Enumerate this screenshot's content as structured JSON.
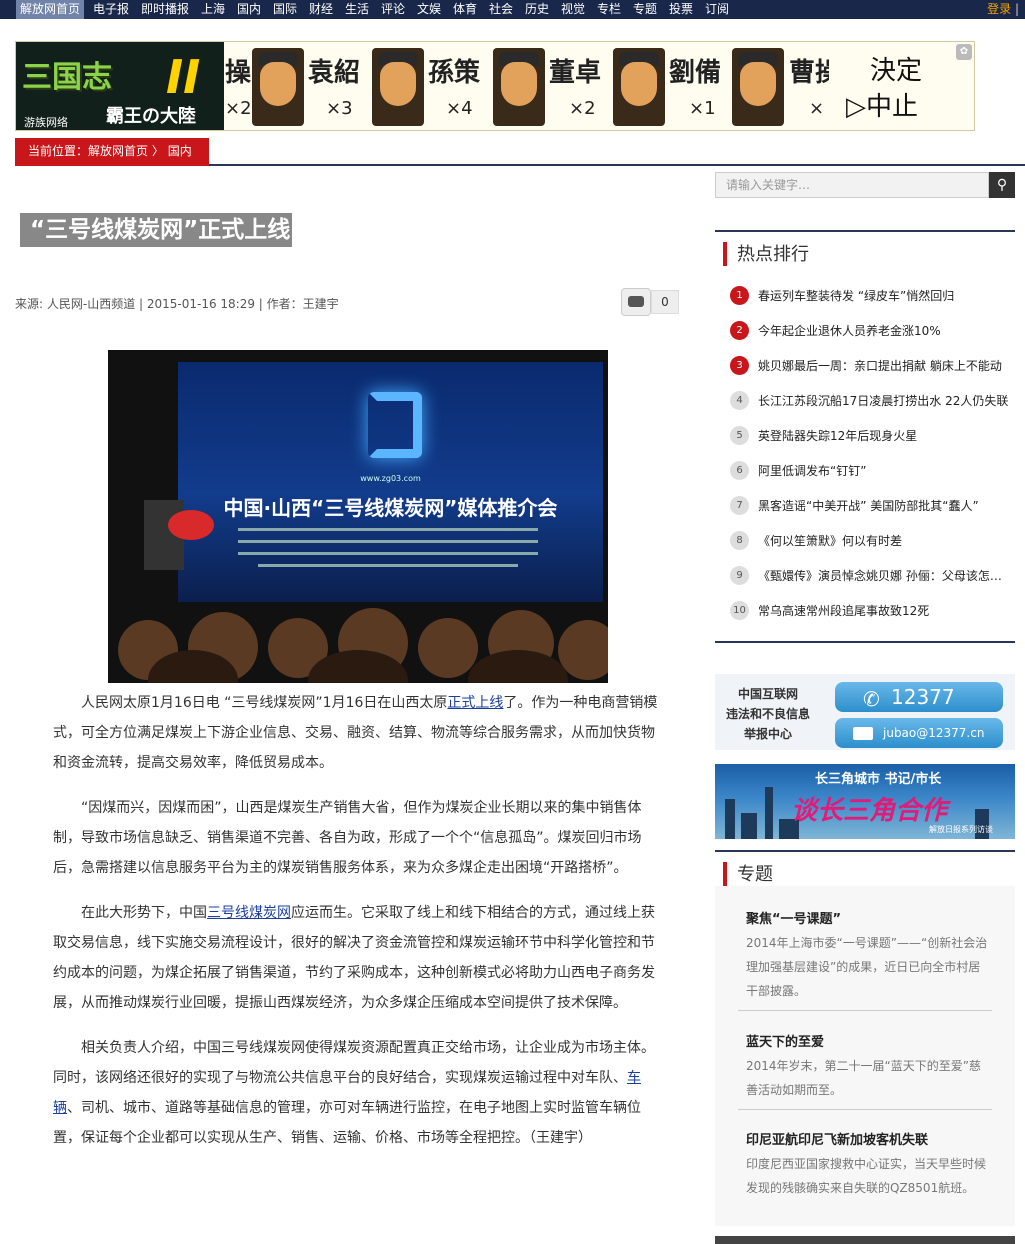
{
  "topnav": {
    "items": [
      "解放网首页",
      "电子报",
      "即时播报",
      "上海",
      "国内",
      "国际",
      "财经",
      "生活",
      "评论",
      "文娱",
      "体育",
      "社会",
      "历史",
      "视觉",
      "专栏",
      "专题",
      "投票",
      "订阅"
    ],
    "login": "登录",
    "sep": "|"
  },
  "banner": {
    "logo_title": "三国志",
    "logo_numeral": "II",
    "logo_subtitle": "霸王の大陸",
    "logo_brand": "游族网络",
    "generals": [
      {
        "name": "袁紹",
        "count": "×3"
      },
      {
        "name": "孫策",
        "count": "×4"
      },
      {
        "name": "董卓",
        "count": "×2"
      },
      {
        "name": "劉備",
        "count": "×1"
      },
      {
        "name": "曹操",
        "count": "×"
      }
    ],
    "lead_name": "操",
    "lead_count": "×2",
    "decide_label": "決定",
    "stop_label": "▷中止"
  },
  "breadcrumb": {
    "label": "当前位置：",
    "home": "解放网首页",
    "sep": "〉",
    "current": "国内"
  },
  "search": {
    "placeholder": "请输入关键字…",
    "button_icon": "search-icon"
  },
  "article": {
    "title": "“三号线煤炭网”正式上线",
    "meta": "来源: 人民网-山西频道 | 2015-01-16 18:29 | 作者：王建宇",
    "comment_count": "0",
    "photo": {
      "url_text": "www.zg03.com",
      "screen_title": "中国·山西“三号线煤炭网”媒体推介会"
    },
    "p1_a": "人民网太原1月16日电 “三号线煤炭网”1月16日在山西太原",
    "p1_link": "正式上线",
    "p1_b": "了。作为一种电商营销模式，可全方位满足煤炭上下游企业信息、交易、融资、结算、物流等综合服务需求，从而加快货物和资金流转，提高交易效率，降低贸易成本。",
    "p2": "“因煤而兴，因煤而困”，山西是煤炭生产销售大省，但作为煤炭企业长期以来的集中销售体制，导致市场信息缺乏、销售渠道不完善、各自为政，形成了一个个“信息孤岛”。煤炭回归市场后，急需搭建以信息服务平台为主的煤炭销售服务体系，来为众多煤企走出困境“开路搭桥”。",
    "p3_a": "在此大形势下，中国",
    "p3_link": "三号线煤炭网",
    "p3_b": "应运而生。它采取了线上和线下相结合的方式，通过线上获取交易信息，线下实施交易流程设计，很好的解决了资金流管控和煤炭运输环节中科学化管控和节约成本的问题，为煤企拓展了销售渠道，节约了采购成本，这种创新模式必将助力山西电子商务发展，从而推动煤炭行业回暖，提振山西煤炭经济，为众多煤企压缩成本空间提供了技术保障。",
    "p4_a": "相关负责人介绍，中国三号线煤炭网使得煤炭资源配置真正交给市场，让企业成为市场主体。同时，该网络还很好的实现了与物流公共信息平台的良好结合，实现煤炭运输过程中对车队、",
    "p4_link": "车辆",
    "p4_b": "、司机、城市、道路等基础信息的管理，亦可对车辆进行监控，在电子地图上实时监管车辆位置，保证每个企业都可以实现从生产、销售、运输、价格、市场等全程把控。（王建宇）"
  },
  "hot": {
    "title": "热点排行",
    "items": [
      {
        "rank": "1",
        "text": "春运列车整装待发 “绿皮车”悄然回归"
      },
      {
        "rank": "2",
        "text": "今年起企业退休人员养老金涨10%"
      },
      {
        "rank": "3",
        "text": "姚贝娜最后一周：亲口提出捐献 躺床上不能动"
      },
      {
        "rank": "4",
        "text": "长江江苏段沉船17日凌晨打捞出水 22人仍失联"
      },
      {
        "rank": "5",
        "text": "英登陆器失踪12年后现身火星"
      },
      {
        "rank": "6",
        "text": "阿里低调发布“钉钉”"
      },
      {
        "rank": "7",
        "text": "黑客造谣“中美开战” 美国防部批其“蠢人”"
      },
      {
        "rank": "8",
        "text": "《何以笙箫默》何以有时差"
      },
      {
        "rank": "9",
        "text": "《甄嬛传》演员悼念姚贝娜 孙俪：父母该怎么办"
      },
      {
        "rank": "10",
        "text": "常乌高速常州段追尾事故致12死"
      }
    ]
  },
  "report": {
    "line1": "中国互联网",
    "line2": "违法和不良信息",
    "line3": "举报中心",
    "phone": "12377",
    "email": "jubao@12377.cn"
  },
  "city_banner": {
    "top": "长三角城市 书记/市长",
    "main": "谈长三角合作",
    "sub": "解放日报系列访谈"
  },
  "topics": {
    "title": "专题",
    "items": [
      {
        "title": "聚焦“一号课题”",
        "desc": "2014年上海市委“一号课题”——“创新社会治理加强基层建设”的成果，近日已向全市村居干部披露。"
      },
      {
        "title": "蓝天下的至爱",
        "desc": "2014年岁末，第二十一届“蓝天下的至爱”慈善活动如期而至。"
      },
      {
        "title": "印尼亚航印尼飞新加坡客机失联",
        "desc": "印度尼西亚国家搜救中心证实，当天早些时候发现的残骸确实来自失联的QZ8501航班。"
      }
    ]
  }
}
